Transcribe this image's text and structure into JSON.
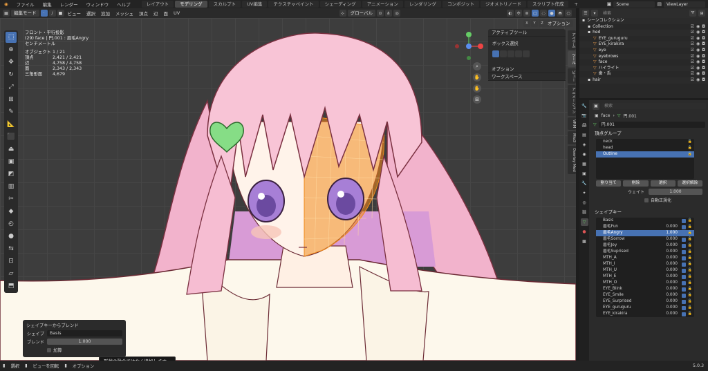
{
  "menu": [
    "ファイル",
    "編集",
    "レンダー",
    "ウィンドウ",
    "ヘルプ"
  ],
  "workspaces": [
    "レイアウト",
    "モデリング",
    "スカルプト",
    "UV編集",
    "テクスチャペイント",
    "シェーディング",
    "アニメーション",
    "レンダリング",
    "コンポジット",
    "ジオメトリノード",
    "スクリプト作成"
  ],
  "active_workspace": "モデリング",
  "scene": "Scene",
  "view_layer": "ViewLayer",
  "viewport_header": {
    "mode": "編集モード",
    "menus": [
      "ビュー",
      "選択",
      "追加",
      "メッシュ",
      "頂点",
      "辺",
      "面",
      "UV"
    ],
    "orientation": "グローバル",
    "options": "オプション"
  },
  "overlay_info": {
    "view": "フロント・平行投影",
    "object": "(29) face | 円.001 : 眉毛Angry",
    "unit": "センチメートル",
    "stats": [
      {
        "k": "オブジェクト",
        "v": "1 / 21"
      },
      {
        "k": "頂点",
        "v": "2,421 / 2,421"
      },
      {
        "k": "辺",
        "v": "4,758 / 4,758"
      },
      {
        "k": "面",
        "v": "2,343 / 2,343"
      },
      {
        "k": "三角形面",
        "v": "4,679"
      }
    ]
  },
  "npanel": {
    "active_tool": "アクティブツール",
    "tool_name": "ボックス選択",
    "options": "オプション",
    "workspace": "ワークスペース"
  },
  "side_tabs": [
    "アイテム",
    "ツール",
    "ビュー",
    "アニメーション",
    "VRM",
    "Mio3",
    "Overlay Mod"
  ],
  "redo_panel": {
    "title": "シェイプキーからブレンド",
    "shape_label": "シェイプ",
    "shape_value": "Basis",
    "blend_label": "ブレンド",
    "blend_value": "1.000",
    "add_label": "加算"
  },
  "tooltip": "形状の融合ではなく追加します。",
  "status": {
    "select": "選択",
    "rotate": "ビューを回転",
    "options": "オプション",
    "version": "5.0.3"
  },
  "outliner": {
    "search_placeholder": "検索",
    "rows": [
      {
        "name": "シーンコレクション",
        "indent": 0
      },
      {
        "name": "Collection",
        "indent": 1
      },
      {
        "name": "hed",
        "indent": 1
      },
      {
        "name": "EYE_guruguru",
        "indent": 2
      },
      {
        "name": "EYE_kirakira",
        "indent": 2
      },
      {
        "name": "eye",
        "indent": 2
      },
      {
        "name": "eyebrows",
        "indent": 2
      },
      {
        "name": "face",
        "indent": 2
      },
      {
        "name": "ハイライト",
        "indent": 2
      },
      {
        "name": "歯・舌",
        "indent": 2
      },
      {
        "name": "hair",
        "indent": 1
      }
    ]
  },
  "properties": {
    "search_placeholder": "検索",
    "breadcrumb_object": "face",
    "breadcrumb_mesh": "円.001",
    "mesh_name": "円.001",
    "vertex_groups_title": "頂点グループ",
    "vertex_groups": [
      "neck",
      "head",
      "Outline"
    ],
    "vg_buttons": [
      "割り当て",
      "削除",
      "選択",
      "選択解除"
    ],
    "weight_label": "ウェイト",
    "weight_value": "1.000",
    "normalize_label": "自動正規化",
    "shape_keys_title": "シェイプキー",
    "shape_keys": [
      {
        "name": "Basis",
        "value": ""
      },
      {
        "name": "眉毛Fun",
        "value": "0.000"
      },
      {
        "name": "眉毛Angry",
        "value": "1.000"
      },
      {
        "name": "眉毛Sorrow",
        "value": "0.000"
      },
      {
        "name": "眉毛Joy",
        "value": "0.000"
      },
      {
        "name": "眉毛Suprised",
        "value": "0.000"
      },
      {
        "name": "MTH_A",
        "value": "0.000"
      },
      {
        "name": "MTH_I",
        "value": "0.000"
      },
      {
        "name": "MTH_U",
        "value": "0.000"
      },
      {
        "name": "MTH_E",
        "value": "0.000"
      },
      {
        "name": "MTH_O",
        "value": "0.000"
      },
      {
        "name": "EYE_Blink",
        "value": "0.000"
      },
      {
        "name": "EYE_Smile",
        "value": "0.000"
      },
      {
        "name": "EYE_Surprised",
        "value": "0.000"
      },
      {
        "name": "EYE_guruguru",
        "value": "0.000"
      },
      {
        "name": "EYE_kirakira",
        "value": "0.000"
      }
    ]
  },
  "colors": {
    "accent": "#4772b3",
    "hair": "#f8c4d6",
    "mesh": "#f08a1c"
  }
}
